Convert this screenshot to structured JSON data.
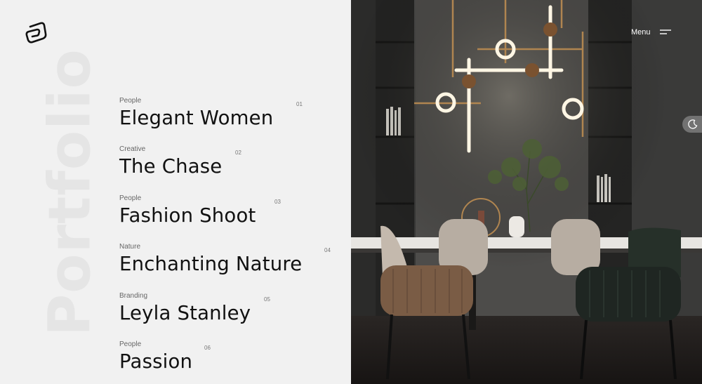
{
  "brand": {
    "logo_icon": "loop-logo-icon"
  },
  "background_word": "Portfolio",
  "nav": {
    "menu_label": "Menu",
    "menu_icon": "hamburger-icon"
  },
  "theme_toggle": {
    "icon": "moon-icon"
  },
  "portfolio_items": [
    {
      "category": "People",
      "title": "Elegant Women",
      "number": "01"
    },
    {
      "category": "Creative",
      "title": "The Chase",
      "number": "02"
    },
    {
      "category": "People",
      "title": "Fashion Shoot",
      "number": "03"
    },
    {
      "category": "Nature",
      "title": "Enchanting Nature",
      "number": "04"
    },
    {
      "category": "Branding",
      "title": "Leyla Stanley",
      "number": "05"
    },
    {
      "category": "People",
      "title": "Passion",
      "number": "06"
    }
  ],
  "colors": {
    "panel": "#f1f1f1",
    "text": "#111111",
    "faded_word": "#e5e5e5",
    "lamp_glow": "#fff6e4",
    "brass": "#a87a45"
  }
}
